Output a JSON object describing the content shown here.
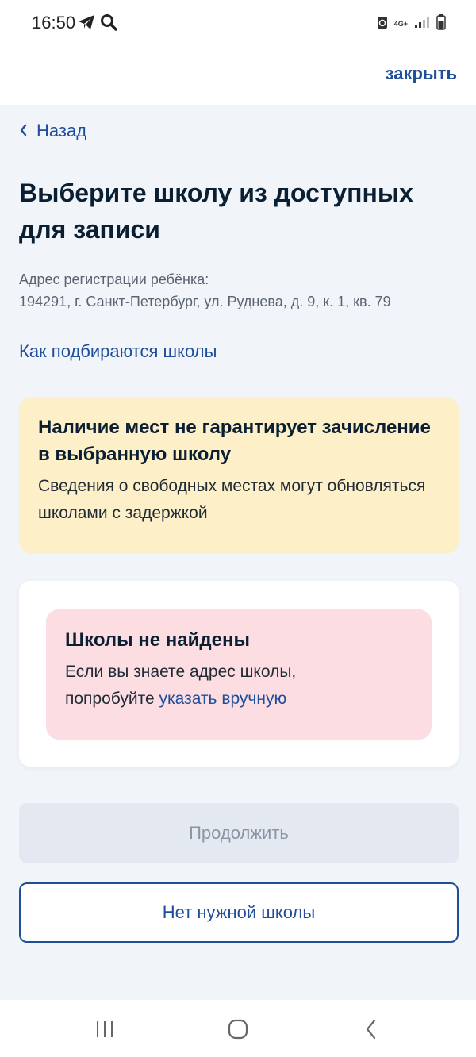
{
  "status_bar": {
    "time": "16:50",
    "network": "4G+"
  },
  "header": {
    "close_label": "закрыть"
  },
  "nav": {
    "back_label": "Назад"
  },
  "page": {
    "title": "Выберите школу из доступных для записи",
    "address_label": "Адрес регистрации ребёнка:",
    "address_value": "194291, г. Санкт-Петербург, ул. Руднева, д. 9, к. 1, кв. 79",
    "how_link": "Как подбираются школы"
  },
  "warning": {
    "title": "Наличие мест не гарантирует зачисление в выбранную школу",
    "text": "Сведения о свободных местах могут обновляться школами с задержкой"
  },
  "not_found": {
    "title": "Школы не найдены",
    "text_line1": "Если вы знаете адрес школы,",
    "text_prefix": "попробуйте ",
    "link": "указать вручную"
  },
  "buttons": {
    "continue": "Продолжить",
    "no_school": "Нет нужной школы"
  },
  "colors": {
    "accent": "#1f4e9a",
    "page_bg": "#f1f4f9",
    "warning_bg": "#fdefc8",
    "error_bg": "#fbdde2",
    "disabled_bg": "#e4e8f1"
  },
  "icons": {
    "status": [
      "telegram-icon",
      "search-icon",
      "recycle-icon",
      "signal-icon",
      "battery-icon"
    ],
    "back": "chevron-left-icon",
    "navbar": [
      "recent-apps-icon",
      "home-icon",
      "back-icon"
    ]
  }
}
